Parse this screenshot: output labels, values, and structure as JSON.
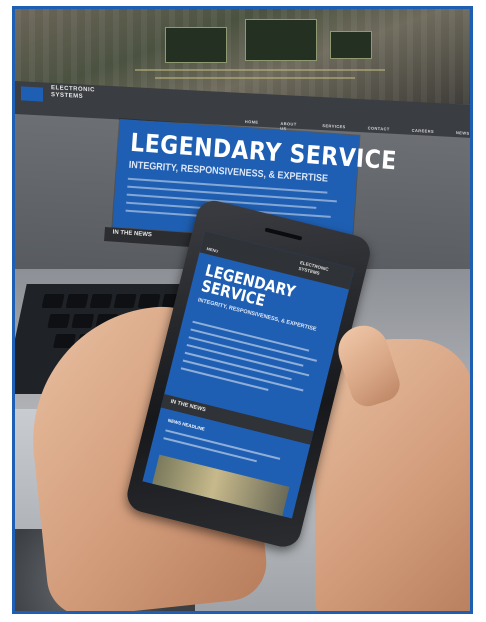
{
  "scene": {
    "frame_border_color": "#1f5fb3",
    "accent_color": "#1f5fb3"
  },
  "monitor": {
    "logo_text": "ELECTRONIC SYSTEMS",
    "nav_items": [
      "HOME",
      "ABOUT US",
      "SERVICES",
      "CONTACT",
      "CAREERS",
      "NEWS"
    ],
    "hero_title": "LEGENDARY SERVICE",
    "hero_subtitle": "INTEGRITY, RESPONSIVENESS, & EXPERTISE",
    "news_bar": "IN THE NEWS"
  },
  "phone": {
    "logo_text": "ELECTRONIC SYSTEMS",
    "menu_label": "MENU",
    "title": "LEGENDARY SERVICE",
    "subtitle": "INTEGRITY, RESPONSIVENESS, & EXPERTISE",
    "news_bar": "IN THE NEWS",
    "news_heading": "NEWS HEADLINE"
  }
}
